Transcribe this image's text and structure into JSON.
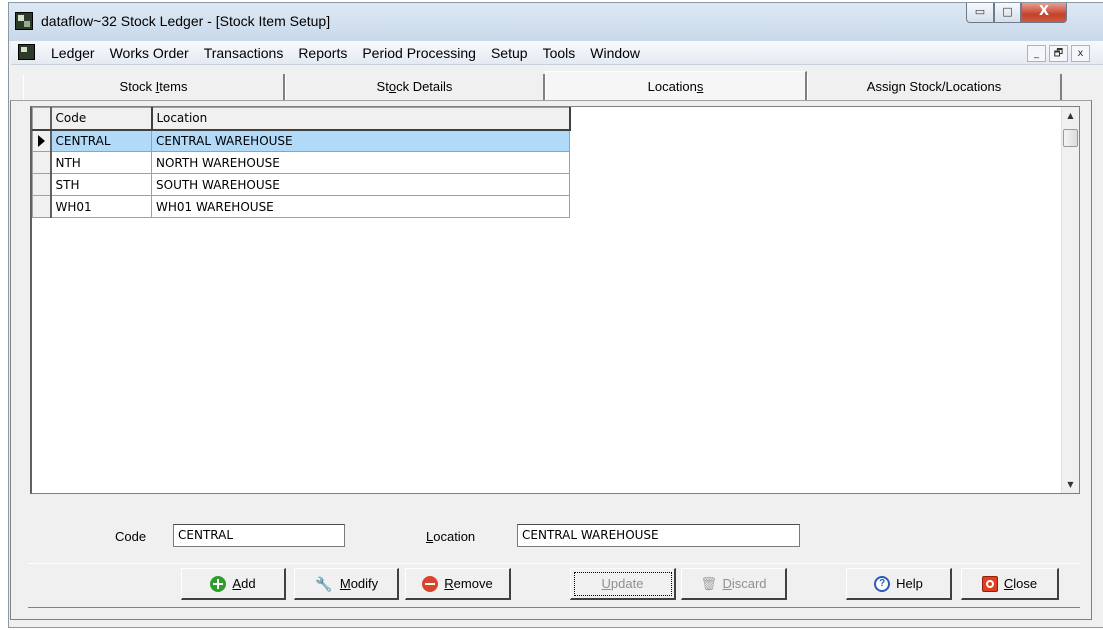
{
  "window": {
    "title": "dataflow~32 Stock Ledger - [Stock Item Setup]",
    "min_glyph": "▭",
    "max_glyph": "□",
    "close_glyph": "X"
  },
  "menu": {
    "items": [
      "Ledger",
      "Works Order",
      "Transactions",
      "Reports",
      "Period Processing",
      "Setup",
      "Tools",
      "Window"
    ],
    "mdi_min": "_",
    "mdi_restore": "🗗",
    "mdi_close": "x"
  },
  "tabs": [
    {
      "pre": "Stock ",
      "key": "I",
      "post": "tems"
    },
    {
      "pre": "St",
      "key": "o",
      "post": "ck Details"
    },
    {
      "pre": "Location",
      "key": "s",
      "post": ""
    },
    {
      "pre": "Assi",
      "key": "g",
      "post": "n Stock/Locations"
    }
  ],
  "active_tab": 2,
  "grid": {
    "headers": {
      "code": "Code",
      "location": "Location"
    },
    "rows": [
      {
        "code": "CENTRAL",
        "location": "CENTRAL WAREHOUSE"
      },
      {
        "code": "NTH",
        "location": "NORTH WAREHOUSE"
      },
      {
        "code": "STH",
        "location": "SOUTH WAREHOUSE"
      },
      {
        "code": "WH01",
        "location": "WH01 WAREHOUSE"
      }
    ],
    "selected_index": 0
  },
  "form": {
    "code_label": "Code",
    "code_value": "CENTRAL",
    "location_label_key": "L",
    "location_label_rest": "ocation",
    "location_value": "CENTRAL WAREHOUSE"
  },
  "buttons": {
    "add": {
      "key": "A",
      "rest": "dd"
    },
    "modify": {
      "key": "M",
      "rest": "odify"
    },
    "remove": {
      "key": "R",
      "rest": "emove"
    },
    "update": {
      "key": "U",
      "rest": "pdate"
    },
    "discard": {
      "key": "D",
      "rest": "iscard"
    },
    "help": {
      "label": "Help",
      "icon": "?"
    },
    "close": {
      "key": "C",
      "rest": "lose"
    }
  }
}
